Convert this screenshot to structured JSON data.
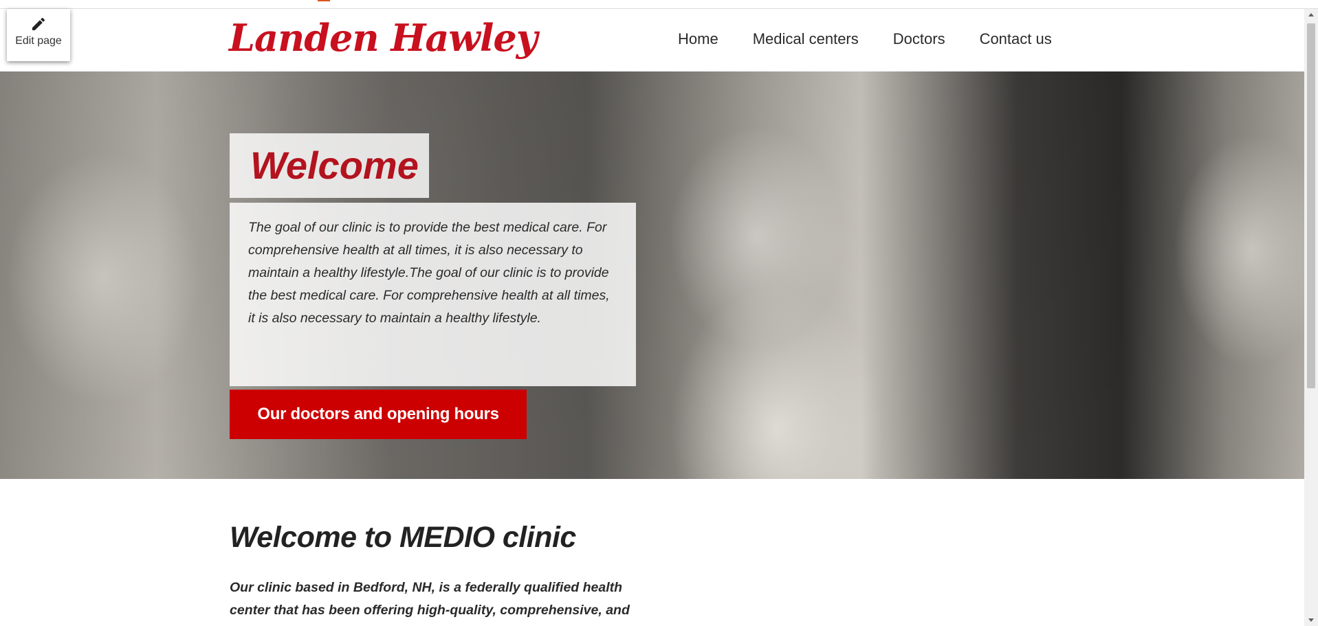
{
  "edit": {
    "label": "Edit page",
    "icon": "pencil-icon"
  },
  "header": {
    "logo": "Landen Hawley",
    "nav": [
      "Home",
      "Medical centers",
      "Doctors",
      "Contact us"
    ]
  },
  "hero": {
    "title": "Welcome",
    "text": "The goal of our clinic is to provide the best medical care. For comprehensive health at all times, it is also necessary to maintain a healthy lifestyle.The goal of our clinic is to provide the best medical care. For comprehensive health at all times, it is also necessary to maintain a healthy lifestyle.",
    "cta_label": "Our doctors and opening hours"
  },
  "content": {
    "heading": "Welcome to MEDIO clinic",
    "intro": "Our clinic based in Bedford, NH, is a federally qualified health center that has been offering high-quality, comprehensive, and"
  },
  "colors": {
    "brand": "#c8101e",
    "cta": "#cc0000",
    "text": "#2a2a2a"
  }
}
